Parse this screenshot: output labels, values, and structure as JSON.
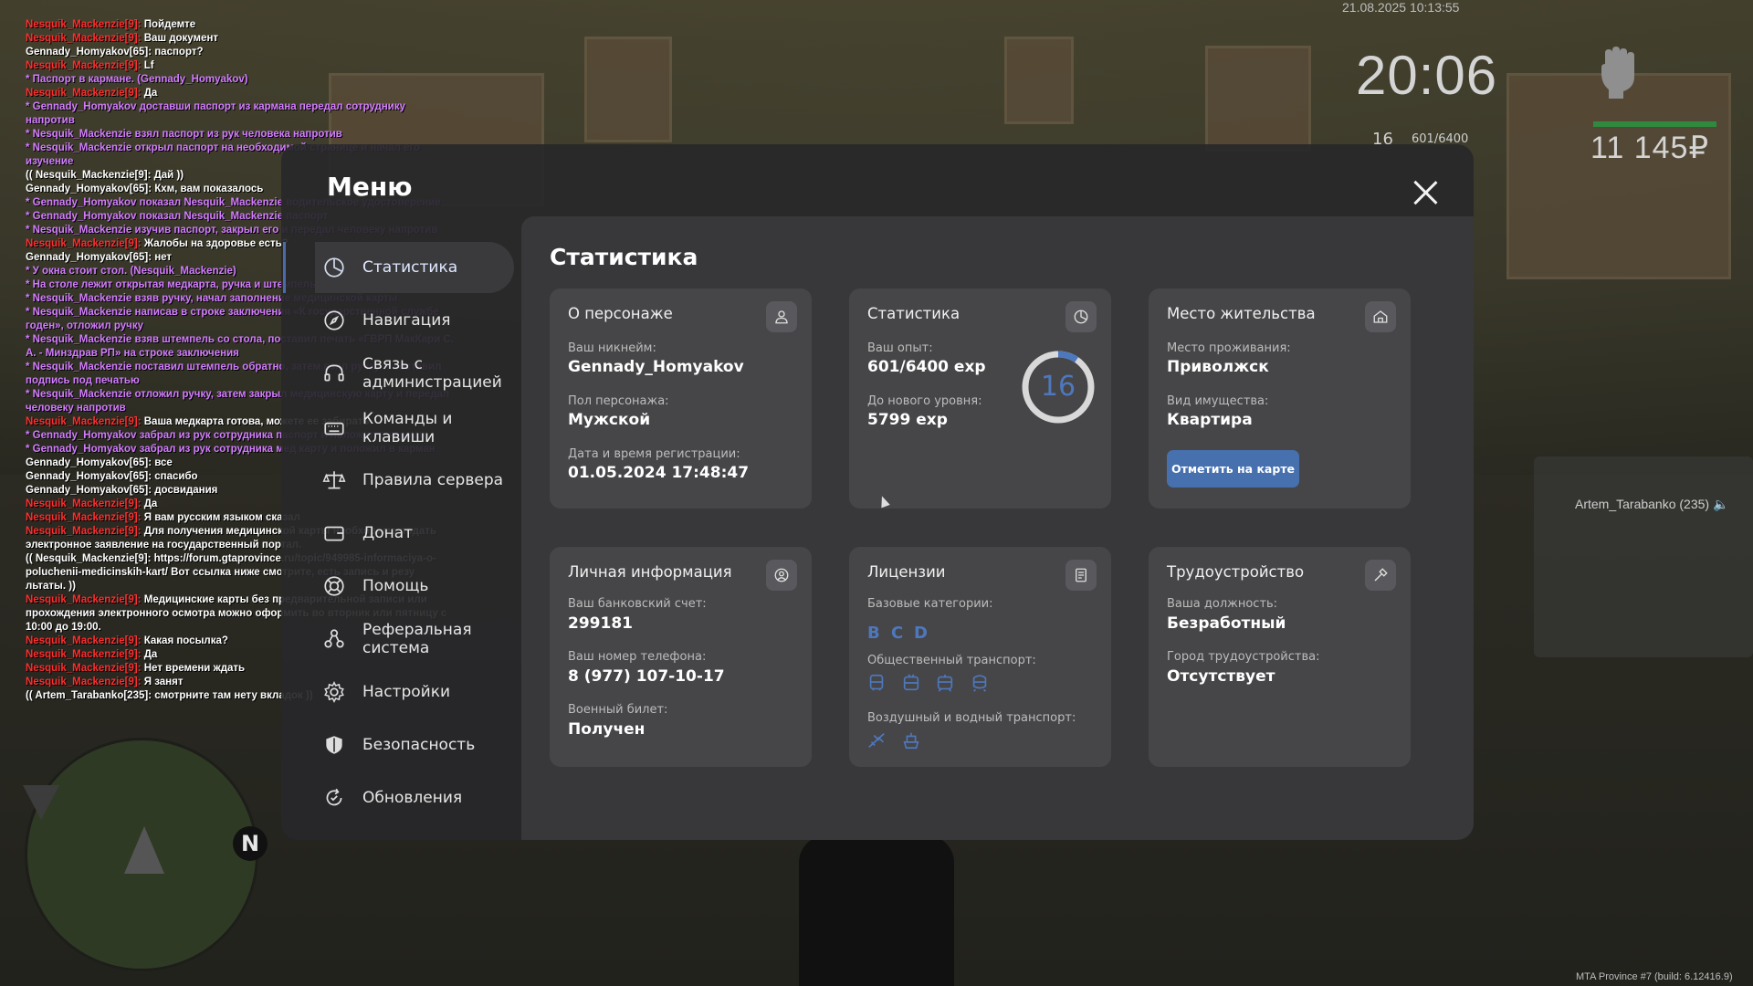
{
  "chat": [
    {
      "nick": "Nesquik_Mackenzie[9]:",
      "text": " Пойдемте",
      "type": "npc"
    },
    {
      "nick": "Nesquik_Mackenzie[9]:",
      "text": " Ваш документ",
      "type": "npc"
    },
    {
      "nick": "",
      "text": "Gennady_Homyakov[65]: паспорт?",
      "type": "say"
    },
    {
      "nick": "Nesquik_Mackenzie[9]:",
      "text": " Lf",
      "type": "npc"
    },
    {
      "nick": "",
      "text": "* Паспорт в кармане. (Gennady_Homyakov)",
      "type": "me"
    },
    {
      "nick": "Nesquik_Mackenzie[9]:",
      "text": " Да",
      "type": "npc"
    },
    {
      "nick": "",
      "text": "* Gennady_Homyakov доставши паспорт из кармана передал сотруднику напротив",
      "type": "me"
    },
    {
      "nick": "",
      "text": "* Nesquik_Mackenzie взял паспорт из рук человека напротив",
      "type": "me"
    },
    {
      "nick": "",
      "text": "* Nesquik_Mackenzie открыл паспорт на необходимой странице и начал его изучение",
      "type": "me"
    },
    {
      "nick": "",
      "text": "(( Nesquik_Mackenzie[9]: Дай ))",
      "type": "say"
    },
    {
      "nick": "",
      "text": "Gennady_Homyakov[65]: Кхм, вам показалось",
      "type": "say"
    },
    {
      "nick": "",
      "text": "* Gennady_Homyakov показал Nesquik_Mackenzie водительское удостоверение",
      "type": "me"
    },
    {
      "nick": "",
      "text": "* Gennady_Homyakov показал Nesquik_Mackenzie паспорт",
      "type": "me"
    },
    {
      "nick": "",
      "text": "* Nesquik_Mackenzie изучив паспорт, закрыл его и передал человеку напротив",
      "type": "me"
    },
    {
      "nick": "Nesquik_Mackenzie[9]:",
      "text": " Жалобы на здоровье есть?",
      "type": "npc"
    },
    {
      "nick": "",
      "text": "Gennady_Homyakov[65]: нет",
      "type": "say"
    },
    {
      "nick": "",
      "text": "* У окна стоит стол. (Nesquik_Mackenzie)",
      "type": "me"
    },
    {
      "nick": "",
      "text": "* На столе лежит открытая медкарта, ручка и штемпель. (Nesquik_Mackenzie)",
      "type": "me"
    },
    {
      "nick": "",
      "text": "* Nesquik_Mackenzie взяв ручку, начал заполнение медицинской карты",
      "type": "me"
    },
    {
      "nick": "",
      "text": "* Nesquik_Mackenzie написав в строке заключения «К государственной службе годен», отложил ручку",
      "type": "me"
    },
    {
      "nick": "",
      "text": "* Nesquik_Mackenzie взяв штемпель со стола, поставил печать «ГВРП МакКари С. А. - Минздрав РП» на строке заключения",
      "type": "me"
    },
    {
      "nick": "",
      "text": "* Nesquik_Mackenzie поставил штемпель обратно, затем взял ручку и поставил подпись под печатью",
      "type": "me"
    },
    {
      "nick": "",
      "text": "* Nesquik_Mackenzie отложил ручку, затем закрыл медицинскую карту и передал человеку напротив",
      "type": "me"
    },
    {
      "nick": "Nesquik_Mackenzie[9]:",
      "text": " Ваша медкарта готова, можете ее забирать",
      "type": "npc"
    },
    {
      "nick": "",
      "text": "* Gennady_Homyakov забрал из рук сотрудника паспорт и положил в карман",
      "type": "me"
    },
    {
      "nick": "",
      "text": "* Gennady_Homyakov забрал из рук сотрудника мед карту и положил в карман",
      "type": "me"
    },
    {
      "nick": "",
      "text": "Gennady_Homyakov[65]: все",
      "type": "say"
    },
    {
      "nick": "",
      "text": "Gennady_Homyakov[65]: спасибо",
      "type": "say"
    },
    {
      "nick": "",
      "text": "Gennady_Homyakov[65]: досвидания",
      "type": "say"
    },
    {
      "nick": "Nesquik_Mackenzie[9]:",
      "text": " Да",
      "type": "npc"
    },
    {
      "nick": "Nesquik_Mackenzie[9]:",
      "text": " Я вам русским языком сказал",
      "type": "npc"
    },
    {
      "nick": "Nesquik_Mackenzie[9]:",
      "text": " Для получения медицинской карты необходимо подать электронное заявление на государственный портал.",
      "type": "npc"
    },
    {
      "nick": "",
      "text": "(( Nesquik_Mackenzie[9]: https://forum.gtaprovince.ru/topic/949985-informaciya-o-poluchenii-medicinskih-kart/ Вот ссылка ниже смотрите, есть запись и резу льтаты. ))",
      "type": "say"
    },
    {
      "nick": "Nesquik_Mackenzie[9]:",
      "text": " Медицинские карты без предварительной записи или прохождения электронного осмотра можно оформить во вторник или пятницу с 10:00 до 19:00.",
      "type": "npc"
    },
    {
      "nick": "Nesquik_Mackenzie[9]:",
      "text": " Какая посылка?",
      "type": "npc"
    },
    {
      "nick": "Nesquik_Mackenzie[9]:",
      "text": " Да",
      "type": "npc"
    },
    {
      "nick": "Nesquik_Mackenzie[9]:",
      "text": " Нет времени ждать",
      "type": "npc"
    },
    {
      "nick": "Nesquik_Mackenzie[9]:",
      "text": " Я занят",
      "type": "npc"
    },
    {
      "nick": "",
      "text": "(( Artem_Tarabanko[235]: смотрните там нету вкладок ))",
      "type": "say"
    }
  ],
  "hud": {
    "datetime": "21.08.2025 10:13:55",
    "time": "20:06",
    "level": "16",
    "exp": "601/6400",
    "money": "11 145₽",
    "speaker": "Artem_Tarabanko (235) 🔈",
    "build": "MTA Province #7 (build: 6.12416.9)",
    "compass": "N"
  },
  "menu": {
    "title": "Меню",
    "sidebar": [
      {
        "label": "Статистика",
        "icon": "pie-chart-icon"
      },
      {
        "label": "Навигация",
        "icon": "compass-icon"
      },
      {
        "label": "Связь с администрацией",
        "icon": "headset-icon"
      },
      {
        "label": "Команды и клавиши",
        "icon": "keyboard-icon"
      },
      {
        "label": "Правила сервера",
        "icon": "scales-icon"
      },
      {
        "label": "Донат",
        "icon": "wallet-icon"
      },
      {
        "label": "Помощь",
        "icon": "lifebuoy-icon"
      },
      {
        "label": "Реферальная система",
        "icon": "referral-icon"
      },
      {
        "label": "Настройки",
        "icon": "gear-icon"
      },
      {
        "label": "Безопасность",
        "icon": "shield-icon"
      },
      {
        "label": "Обновления",
        "icon": "refresh-icon"
      }
    ],
    "content_title": "Статистика"
  },
  "cards": {
    "character": {
      "title": "О персонаже",
      "icon": "user-icon",
      "nick_label": "Ваш никнейм:",
      "nick": "Gennady_Homyakov",
      "gender_label": "Пол персонажа:",
      "gender": "Мужской",
      "reg_label": "Дата и время регистрации:",
      "reg": "01.05.2024 17:48:47"
    },
    "stats": {
      "title": "Статистика",
      "icon": "pie-chart-icon",
      "exp_label": "Ваш опыт:",
      "exp": "601/6400 exp",
      "next_label": "До нового уровня:",
      "next": "5799 exp",
      "level": "16",
      "progress": 0.0939
    },
    "residence": {
      "title": "Место жительства",
      "icon": "home-icon",
      "place_label": "Место проживания:",
      "place": "Приволжск",
      "property_label": "Вид имущества:",
      "property": "Квартира",
      "button": "Отметить на карте"
    },
    "personal": {
      "title": "Личная информация",
      "icon": "user-circle-icon",
      "bank_label": "Ваш банковский счет:",
      "bank": "299181",
      "phone_label": "Ваш номер телефона:",
      "phone": "8 (977) 107-10-17",
      "military_label": "Военный билет:",
      "military": "Получен"
    },
    "licenses": {
      "title": "Лицензии",
      "icon": "document-icon",
      "base_label": "Базовые категории:",
      "categories": [
        "B",
        "C",
        "D"
      ],
      "public_label": "Общественный транспорт:",
      "public_icons": [
        "bus-icon",
        "trolleybus-icon",
        "tram-icon",
        "metro-icon"
      ],
      "airwater_label": "Воздушный и водный транспорт:",
      "airwater_icons": [
        "plane-icon",
        "boat-icon"
      ]
    },
    "job": {
      "title": "Трудоустройство",
      "icon": "hammer-icon",
      "position_label": "Ваша должность:",
      "position": "Безработный",
      "city_label": "Город трудоустройства:",
      "city": "Отсутствует"
    }
  },
  "colors": {
    "accent": "#4e78bd",
    "button": "#4670ae",
    "chat_nick": "#ff2e2e",
    "chat_me": "#d37dff"
  }
}
